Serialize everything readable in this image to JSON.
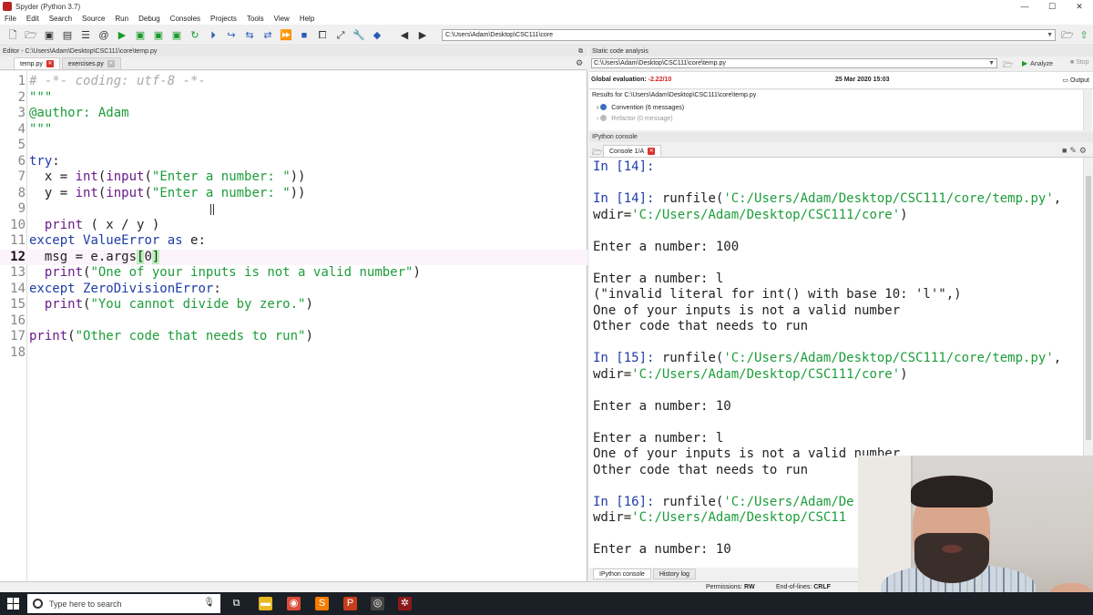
{
  "window": {
    "title": "Spyder (Python 3.7)",
    "controls": [
      "—",
      "☐",
      "✕"
    ]
  },
  "menu": [
    "File",
    "Edit",
    "Search",
    "Source",
    "Run",
    "Debug",
    "Consoles",
    "Projects",
    "Tools",
    "View",
    "Help"
  ],
  "toolbar": {
    "working_dir": "C:\\Users\\Adam\\Desktop\\CSC111\\core"
  },
  "editor": {
    "header": "Editor - C:\\Users\\Adam\\Desktop\\CSC111\\core\\temp.py",
    "tabs": [
      {
        "label": "temp.py",
        "active": true
      },
      {
        "label": "exercises.py",
        "active": false
      }
    ],
    "current_line": 12,
    "lines": [
      {
        "n": "1",
        "tokens": [
          {
            "t": "# -*- coding: utf-8 -*-",
            "c": "comment"
          }
        ]
      },
      {
        "n": "2",
        "tokens": [
          {
            "t": "\"\"\"",
            "c": "doc"
          }
        ]
      },
      {
        "n": "3",
        "tokens": [
          {
            "t": "@author: Adam",
            "c": "doc"
          }
        ]
      },
      {
        "n": "4",
        "tokens": [
          {
            "t": "\"\"\"",
            "c": "doc"
          }
        ]
      },
      {
        "n": "5",
        "tokens": []
      },
      {
        "n": "6",
        "tokens": [
          {
            "t": "try",
            "c": "kw"
          },
          {
            "t": ":",
            "c": ""
          }
        ]
      },
      {
        "n": "7",
        "tokens": [
          {
            "t": "  x = ",
            "c": ""
          },
          {
            "t": "int",
            "c": "bi"
          },
          {
            "t": "(",
            "c": ""
          },
          {
            "t": "input",
            "c": "bi"
          },
          {
            "t": "(",
            "c": ""
          },
          {
            "t": "\"Enter a number: \"",
            "c": "str"
          },
          {
            "t": "))",
            "c": ""
          }
        ]
      },
      {
        "n": "8",
        "tokens": [
          {
            "t": "  y = ",
            "c": ""
          },
          {
            "t": "int",
            "c": "bi"
          },
          {
            "t": "(",
            "c": ""
          },
          {
            "t": "input",
            "c": "bi"
          },
          {
            "t": "(",
            "c": ""
          },
          {
            "t": "\"Enter a number: \"",
            "c": "str"
          },
          {
            "t": "))",
            "c": ""
          }
        ]
      },
      {
        "n": "9",
        "tokens": []
      },
      {
        "n": "10",
        "tokens": [
          {
            "t": "  ",
            "c": ""
          },
          {
            "t": "print",
            "c": "bi"
          },
          {
            "t": " ( x / y )",
            "c": ""
          }
        ]
      },
      {
        "n": "11",
        "tokens": [
          {
            "t": "except",
            "c": "kw"
          },
          {
            "t": " ",
            "c": ""
          },
          {
            "t": "ValueError",
            "c": "kw"
          },
          {
            "t": " ",
            "c": ""
          },
          {
            "t": "as",
            "c": "kw"
          },
          {
            "t": " e:",
            "c": ""
          }
        ]
      },
      {
        "n": "12",
        "tokens": [
          {
            "t": "  msg = e.args",
            "c": ""
          },
          {
            "t": "[",
            "c": "bracket"
          },
          {
            "t": "0",
            "c": ""
          },
          {
            "t": "]",
            "c": "bracket"
          }
        ]
      },
      {
        "n": "13",
        "tokens": [
          {
            "t": "  ",
            "c": ""
          },
          {
            "t": "print",
            "c": "bi"
          },
          {
            "t": "(",
            "c": ""
          },
          {
            "t": "\"One of your inputs is not a valid number\"",
            "c": "str"
          },
          {
            "t": ")",
            "c": ""
          }
        ]
      },
      {
        "n": "14",
        "tokens": [
          {
            "t": "except",
            "c": "kw"
          },
          {
            "t": " ",
            "c": ""
          },
          {
            "t": "ZeroDivisionError",
            "c": "kw"
          },
          {
            "t": ":",
            "c": ""
          }
        ]
      },
      {
        "n": "15",
        "tokens": [
          {
            "t": "  ",
            "c": ""
          },
          {
            "t": "print",
            "c": "bi"
          },
          {
            "t": "(",
            "c": ""
          },
          {
            "t": "\"You cannot divide by zero.\"",
            "c": "str"
          },
          {
            "t": ")",
            "c": ""
          }
        ]
      },
      {
        "n": "16",
        "tokens": []
      },
      {
        "n": "17",
        "tokens": [
          {
            "t": "print",
            "c": "bi"
          },
          {
            "t": "(",
            "c": ""
          },
          {
            "t": "\"Other code that needs to run\"",
            "c": "str"
          },
          {
            "t": ")",
            "c": ""
          }
        ]
      },
      {
        "n": "18",
        "tokens": []
      }
    ]
  },
  "static_analysis": {
    "header": "Static code analysis",
    "path": "C:\\Users\\Adam\\Desktop\\CSC111\\core\\temp.py",
    "analyze_label": "Analyze",
    "stop_label": "Stop",
    "global_eval_label": "Global evaluation:",
    "global_eval_value": "-2.22/10",
    "date": "25 Mar 2020 15:03",
    "output_label": "Output",
    "results_title": "Results for C:\\Users\\Adam\\Desktop\\CSC111\\core\\temp.py",
    "convention": "Convention (6 messages)",
    "refactor": "Refactor (0 message)"
  },
  "console": {
    "header": "IPython console",
    "tab_label": "Console 1/A",
    "bottom_tabs": [
      "IPython console",
      "History log"
    ],
    "lines": [
      [
        {
          "t": "In [",
          "c": "prompt"
        },
        {
          "t": "14",
          "c": "num"
        },
        {
          "t": "]:",
          "c": "prompt"
        }
      ],
      [],
      [
        {
          "t": "In [",
          "c": "prompt"
        },
        {
          "t": "14",
          "c": "num"
        },
        {
          "t": "]: ",
          "c": "prompt"
        },
        {
          "t": "runfile(",
          "c": ""
        },
        {
          "t": "'C:/Users/Adam/Desktop/CSC111/core/temp.py'",
          "c": "cstr"
        },
        {
          "t": ",",
          "c": ""
        }
      ],
      [
        {
          "t": "wdir=",
          "c": ""
        },
        {
          "t": "'C:/Users/Adam/Desktop/CSC111/core'",
          "c": "cstr"
        },
        {
          "t": ")",
          "c": ""
        }
      ],
      [],
      [
        {
          "t": "Enter a number: 100",
          "c": ""
        }
      ],
      [],
      [
        {
          "t": "Enter a number: l",
          "c": ""
        }
      ],
      [
        {
          "t": "(\"invalid literal for int() with base 10: 'l'\",)",
          "c": ""
        }
      ],
      [
        {
          "t": "One of your inputs is not a valid number",
          "c": ""
        }
      ],
      [
        {
          "t": "Other code that needs to run",
          "c": ""
        }
      ],
      [],
      [
        {
          "t": "In [",
          "c": "prompt"
        },
        {
          "t": "15",
          "c": "num"
        },
        {
          "t": "]: ",
          "c": "prompt"
        },
        {
          "t": "runfile(",
          "c": ""
        },
        {
          "t": "'C:/Users/Adam/Desktop/CSC111/core/temp.py'",
          "c": "cstr"
        },
        {
          "t": ",",
          "c": ""
        }
      ],
      [
        {
          "t": "wdir=",
          "c": ""
        },
        {
          "t": "'C:/Users/Adam/Desktop/CSC111/core'",
          "c": "cstr"
        },
        {
          "t": ")",
          "c": ""
        }
      ],
      [],
      [
        {
          "t": "Enter a number: 10",
          "c": ""
        }
      ],
      [],
      [
        {
          "t": "Enter a number: l",
          "c": ""
        }
      ],
      [
        {
          "t": "One of your inputs is not a valid number",
          "c": ""
        }
      ],
      [
        {
          "t": "Other code that needs to run",
          "c": ""
        }
      ],
      [],
      [
        {
          "t": "In [",
          "c": "prompt"
        },
        {
          "t": "16",
          "c": "num"
        },
        {
          "t": "]: ",
          "c": "prompt"
        },
        {
          "t": "runfile(",
          "c": ""
        },
        {
          "t": "'C:/Users/Adam/De",
          "c": "cstr"
        }
      ],
      [
        {
          "t": "wdir=",
          "c": ""
        },
        {
          "t": "'C:/Users/Adam/Desktop/CSC11",
          "c": "cstr"
        }
      ],
      [],
      [
        {
          "t": "Enter a number: 10",
          "c": ""
        }
      ]
    ]
  },
  "statusbar": {
    "permissions_label": "Permissions:",
    "permissions_value": "RW",
    "eol_label": "End-of-lines:",
    "eol_value": "CRLF"
  },
  "taskbar": {
    "search_placeholder": "Type here to search",
    "apps": [
      {
        "name": "task-view-icon",
        "glyph": "⧉",
        "color": "#1b1f26"
      },
      {
        "name": "file-explorer-icon",
        "glyph": "▬",
        "color": "#e8b923"
      },
      {
        "name": "chrome-icon",
        "glyph": "◉",
        "color": "#dd4b39"
      },
      {
        "name": "sublime-icon",
        "glyph": "S",
        "color": "#f57c00"
      },
      {
        "name": "powerpoint-icon",
        "glyph": "P",
        "color": "#c43e1c"
      },
      {
        "name": "obs-icon",
        "glyph": "◎",
        "color": "#444"
      },
      {
        "name": "spyder-icon",
        "glyph": "✲",
        "color": "#8b1a1a"
      }
    ]
  }
}
